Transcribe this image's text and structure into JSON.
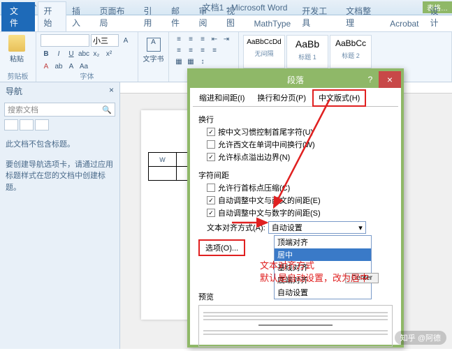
{
  "titlebar": {
    "doc_title": "文档1 - Microsoft Word",
    "badge": "表格…"
  },
  "ribbon": {
    "file": "文件",
    "tabs": [
      "开始",
      "插入",
      "页面布局",
      "引用",
      "邮件",
      "审阅",
      "视图",
      "MathType",
      "开发工具",
      "文档整理",
      "Acrobat",
      "设计"
    ],
    "active_tab": 0,
    "paste": "粘贴",
    "font_size": "小三",
    "group_clipboard": "剪贴板",
    "group_font": "字体",
    "textbox": "文字书",
    "styles": [
      {
        "sample": "AaBbCcDd",
        "name": "无间隔"
      },
      {
        "sample": "AaBb",
        "name": "标题 1"
      },
      {
        "sample": "AaBbCc",
        "name": "标题 2"
      }
    ]
  },
  "nav": {
    "title": "导航",
    "search_placeholder": "搜索文档",
    "msg1": "此文档不包含标题。",
    "msg2": "要创建导航选项卡，请通过应用标题样式在您的文档中创建标题。"
  },
  "table_cell": "W",
  "dialog": {
    "title": "段落",
    "tabs": [
      "缩进和间距(I)",
      "换行和分页(P)",
      "中文版式(H)"
    ],
    "sect_wrap": "换行",
    "chk1": "按中文习惯控制首尾字符(U)",
    "chk2": "允许西文在单词中间换行(W)",
    "chk3": "允许标点溢出边界(N)",
    "sect_spacing": "字符间距",
    "chk4": "允许行首标点压缩(C)",
    "chk5": "自动调整中文与西文的间距(E)",
    "chk6": "自动调整中文与数字的间距(S)",
    "align_label": "文本对齐方式(A):",
    "align_value": "自动设置",
    "dropdown": [
      "顶端对齐",
      "居中",
      "基线对齐",
      "底端对齐",
      "自动设置"
    ],
    "center_btn": "Center",
    "options_btn": "选项(O)...",
    "preview": "预览"
  },
  "annotation": {
    "line1": "文本对齐方式",
    "line2": "默认是自动设置，改为居中"
  },
  "watermark": "知乎 @阿德"
}
